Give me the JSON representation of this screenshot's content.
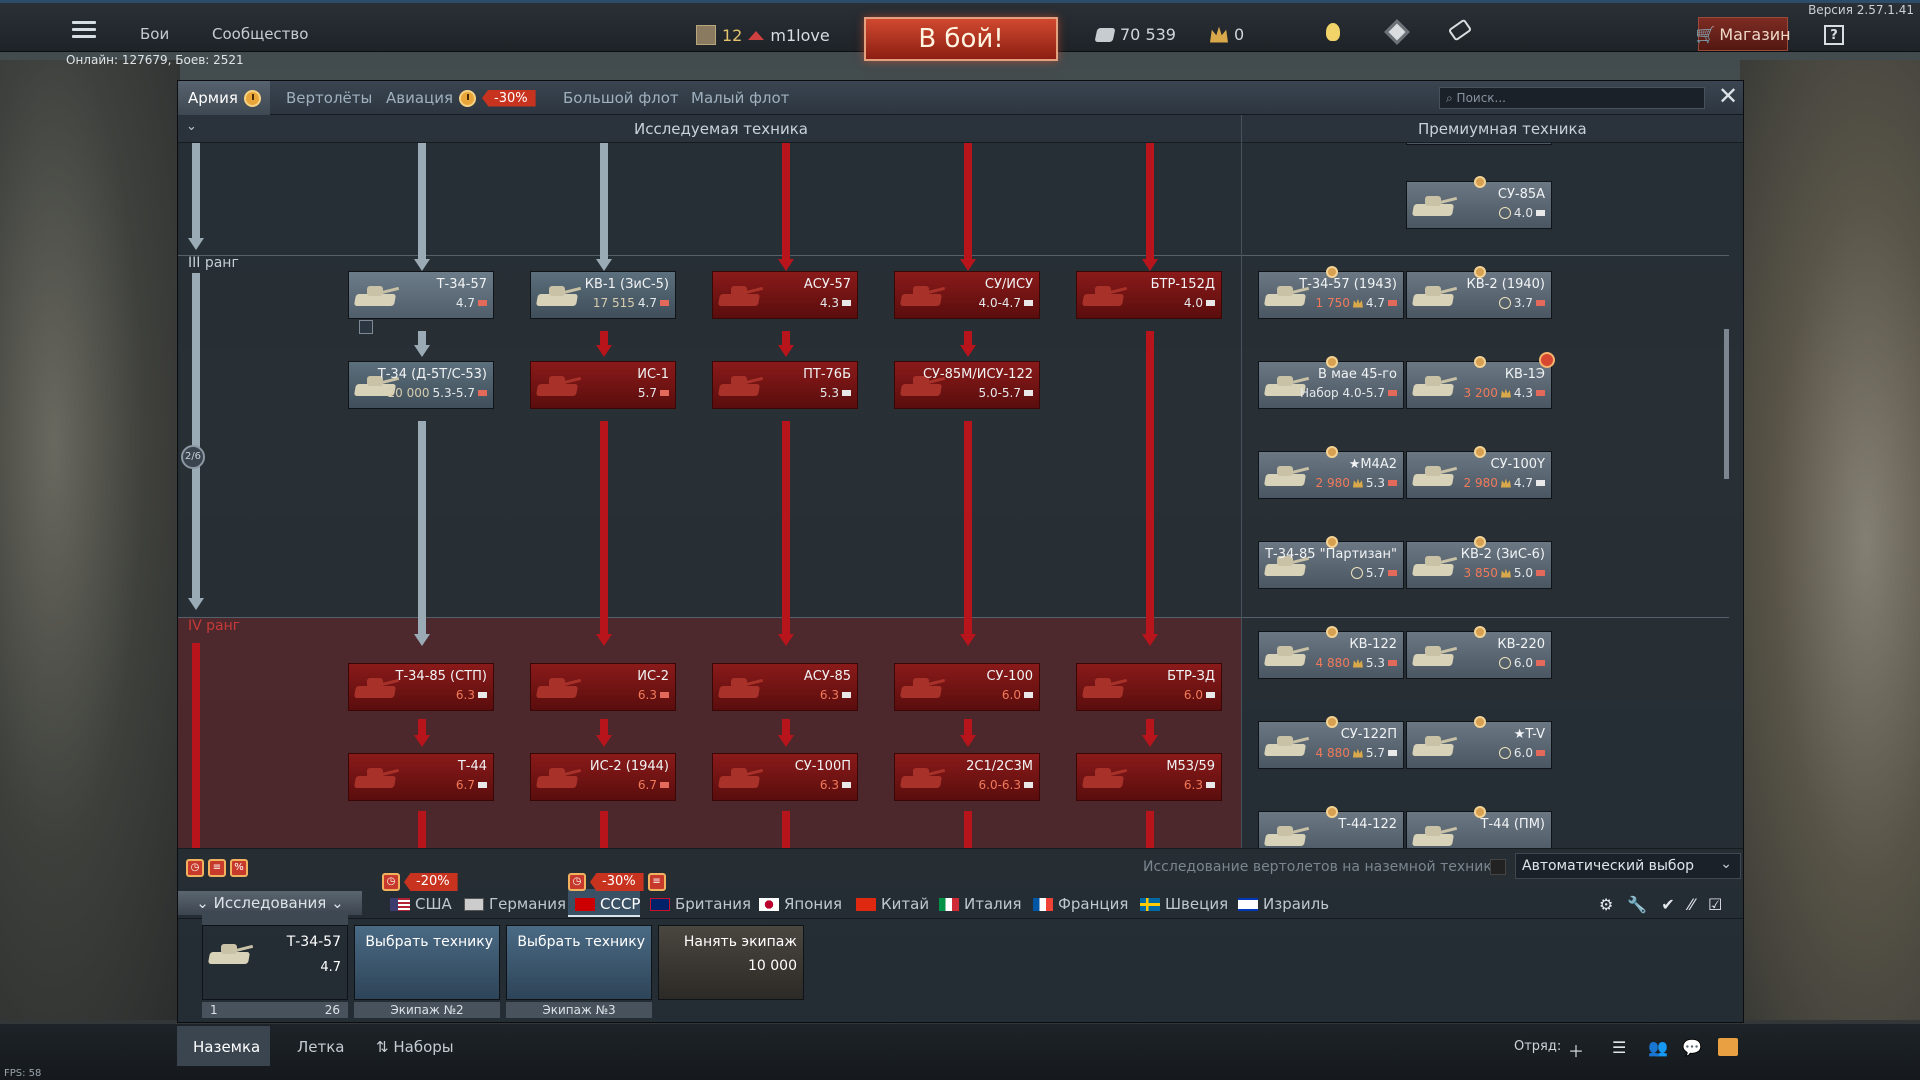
{
  "version": "Версия 2.57.1.41",
  "topbar": {
    "links": [
      "Бои",
      "Сообщество"
    ],
    "player_level": "12",
    "player_name": "m1love",
    "battle_button": "В бой!",
    "silver": "70 539",
    "gold": "0",
    "shop": "Магазин",
    "help": "?"
  },
  "online_status": "Онлайн: 127679, Боев: 2521",
  "tabs": [
    {
      "label": "Армия"
    },
    {
      "label": "Вертолёты"
    },
    {
      "label": "Авиация"
    },
    {
      "label": "Большой флот"
    },
    {
      "label": "Малый флот"
    }
  ],
  "aviation_discount": "-30%",
  "search_placeholder": "Поиск...",
  "headers": {
    "research": "Исследуемая техника",
    "premium": "Премиумная техника"
  },
  "ranks": {
    "rank3": "III ранг",
    "rank4": "IV ранг",
    "progress": "2/6"
  },
  "research_vehicles": [
    {
      "name": "Т-34-57",
      "br": "4.7"
    },
    {
      "name": "КВ-1 (ЗиС-5)",
      "rp": "17 515",
      "br": "4.7"
    },
    {
      "name": "АСУ-57",
      "br": "4.3"
    },
    {
      "name": "СУ/ИСУ",
      "br": "4.0-4.7"
    },
    {
      "name": "БТР-152Д",
      "br": "4.0"
    },
    {
      "name": "Т-34 (Д-5Т/С-53)",
      "rp": "20 000",
      "br": "5.3-5.7"
    },
    {
      "name": "ИС-1",
      "br": "5.7"
    },
    {
      "name": "ПТ-76Б",
      "br": "5.3"
    },
    {
      "name": "СУ-85М/ИСУ-122",
      "br": "5.0-5.7"
    },
    {
      "name": "Т-34-85 (СТП)",
      "br": "6.3"
    },
    {
      "name": "ИС-2",
      "br": "6.3"
    },
    {
      "name": "АСУ-85",
      "br": "6.3"
    },
    {
      "name": "СУ-100",
      "br": "6.0"
    },
    {
      "name": "БТР-ЗД",
      "br": "6.0"
    },
    {
      "name": "Т-44",
      "br": "6.7"
    },
    {
      "name": "ИС-2 (1944)",
      "br": "6.7"
    },
    {
      "name": "СУ-100П",
      "br": "6.3"
    },
    {
      "name": "2С1/2С3М",
      "br": "6.0-6.3"
    },
    {
      "name": "М53/59",
      "br": "6.3"
    }
  ],
  "premium_vehicles": [
    {
      "name": "СУ-85А",
      "br": "4.0",
      "cost": ""
    },
    {
      "name": "Т-34-57 (1943)",
      "br": "4.7",
      "cost": "1 750"
    },
    {
      "name": "КВ-2 (1940)",
      "br": "3.7",
      "cost": ""
    },
    {
      "name": "В мае 45-го",
      "br": "Набор 4.0-5.7",
      "cost": ""
    },
    {
      "name": "КВ-1Э",
      "br": "4.3",
      "cost": "3 200"
    },
    {
      "name": "★М4А2",
      "br": "5.3",
      "cost": "2 980"
    },
    {
      "name": "СУ-100Y",
      "br": "4.7",
      "cost": "2 980"
    },
    {
      "name": "Т-34-85 \"Партизан\"",
      "br": "5.7",
      "cost": ""
    },
    {
      "name": "КВ-2 (ЗиС-6)",
      "br": "5.0",
      "cost": "3 850"
    },
    {
      "name": "КВ-122",
      "br": "5.3",
      "cost": "4 880"
    },
    {
      "name": "КВ-220",
      "br": "6.0",
      "cost": ""
    },
    {
      "name": "СУ-122П",
      "br": "5.7",
      "cost": "4 880"
    },
    {
      "name": "★T-V",
      "br": "6.0",
      "cost": ""
    },
    {
      "name": "Т-44-122",
      "br": "",
      "cost": ""
    },
    {
      "name": "Т-44 (ПМ)",
      "br": "",
      "cost": ""
    }
  ],
  "heli_research_text": "Исследование вертолетов на наземной технике",
  "auto_select": "Автоматический выбор",
  "research_tab": "Исследования",
  "nations": [
    {
      "label": "США",
      "badge": "-20%"
    },
    {
      "label": "Германия"
    },
    {
      "label": "СССР",
      "badge": "-30%"
    },
    {
      "label": "Британия"
    },
    {
      "label": "Япония"
    },
    {
      "label": "Китай"
    },
    {
      "label": "Италия"
    },
    {
      "label": "Франция"
    },
    {
      "label": "Швеция"
    },
    {
      "label": "Израиль"
    }
  ],
  "crew": [
    {
      "label": "Т-34-57",
      "br": "4.7",
      "sub_left": "1",
      "sub_right": "26"
    },
    {
      "label": "Выбрать технику",
      "sub": "Экипаж №2"
    },
    {
      "label": "Выбрать технику",
      "sub": "Экипаж №3"
    },
    {
      "label": "Нанять экипаж",
      "price": "10 000"
    }
  ],
  "bottom_tabs": [
    "Наземка",
    "Летка",
    "Наборы"
  ],
  "squad_label": "Отряд:",
  "fps": "FPS: 58",
  "colors": {
    "battle": "#c0392b",
    "locked": "#8a1a1a",
    "researched": "#5c6f7c",
    "accent_gold": "#e4c36d"
  }
}
